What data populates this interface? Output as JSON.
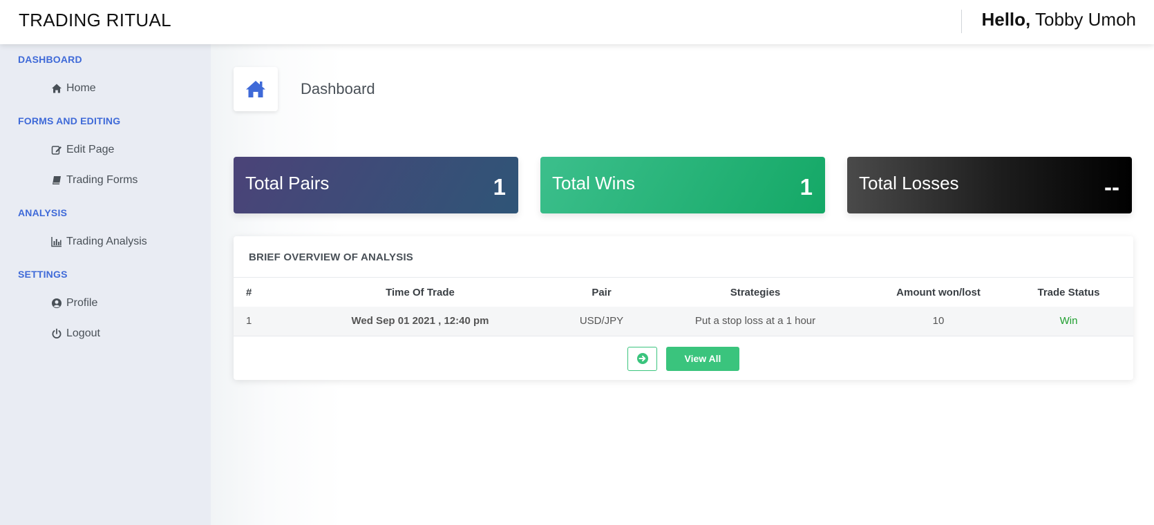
{
  "header": {
    "brand": "TRADING RITUAL",
    "greeting_hello": "Hello,",
    "user_name": "Tobby Umoh"
  },
  "sidebar": {
    "sections": [
      {
        "title": "DASHBOARD",
        "items": [
          {
            "label": "Home",
            "icon": "home-icon"
          }
        ]
      },
      {
        "title": "FORMS AND EDITING",
        "items": [
          {
            "label": "Edit Page",
            "icon": "edit-icon"
          },
          {
            "label": "Trading Forms",
            "icon": "book-icon"
          }
        ]
      },
      {
        "title": "ANALYSIS",
        "items": [
          {
            "label": "Trading Analysis",
            "icon": "bar-chart-icon"
          }
        ]
      },
      {
        "title": "SETTINGS",
        "items": [
          {
            "label": "Profile",
            "icon": "user-circle-icon"
          },
          {
            "label": "Logout",
            "icon": "power-icon"
          }
        ]
      }
    ]
  },
  "page": {
    "title": "Dashboard"
  },
  "stats": {
    "pairs": {
      "label": "Total Pairs",
      "value": "1"
    },
    "wins": {
      "label": "Total Wins",
      "value": "1"
    },
    "losses": {
      "label": "Total Losses",
      "value": "--"
    }
  },
  "overview": {
    "title": "BRIEF OVERVIEW OF ANALYSIS",
    "columns": [
      "#",
      "Time Of Trade",
      "Pair",
      "Strategies",
      "Amount won/lost",
      "Trade Status"
    ],
    "rows": [
      {
        "num": "1",
        "time": "Wed Sep 01 2021 , 12:40 pm",
        "pair": "USD/JPY",
        "strategy": "Put a stop loss at a 1 hour",
        "amount": "10",
        "status": "Win"
      }
    ],
    "view_all_label": "View All"
  },
  "colors": {
    "accent": "#3f6ad8",
    "success": "#3ac47d",
    "win_text": "#1e9e2e",
    "sidebar_bg": "#e9ecf3"
  }
}
